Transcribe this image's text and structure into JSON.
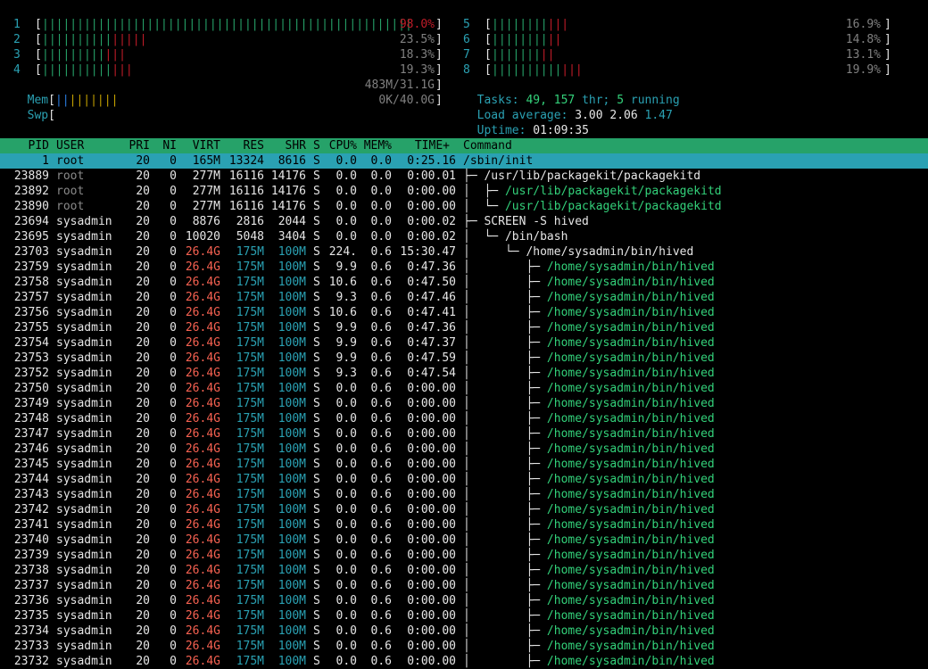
{
  "cpus": [
    {
      "id": "1",
      "value": "98.0%",
      "green": 53,
      "red": 0
    },
    {
      "id": "2",
      "value": "23.5%",
      "green": 10,
      "red": 5
    },
    {
      "id": "3",
      "value": "18.3%",
      "green": 9,
      "red": 3
    },
    {
      "id": "4",
      "value": "19.3%",
      "green": 10,
      "red": 3
    },
    {
      "id": "5",
      "value": "16.9%",
      "green": 8,
      "red": 3
    },
    {
      "id": "6",
      "value": "14.8%",
      "green": 8,
      "red": 2
    },
    {
      "id": "7",
      "value": "13.1%",
      "green": 7,
      "red": 2
    },
    {
      "id": "8",
      "value": "19.9%",
      "green": 10,
      "red": 3
    }
  ],
  "mem": {
    "label": "Mem",
    "value": "483M/31.1G"
  },
  "swp": {
    "label": "Swp",
    "value": "0K/40.0G"
  },
  "tasks": {
    "label": "Tasks:",
    "count": "49,",
    "thr": "157",
    "thr_label": "thr;",
    "running": "5",
    "running_label": "running"
  },
  "load": {
    "label": "Load average:",
    "v1": "3.00",
    "v5": "2.06",
    "v15": "1.47"
  },
  "uptime": {
    "label": "Uptime:",
    "value": "01:09:35"
  },
  "columns": {
    "pid": "PID",
    "user": "USER",
    "pri": "PRI",
    "ni": "NI",
    "virt": "VIRT",
    "res": "RES",
    "shr": "SHR",
    "s": "S",
    "cpu": "CPU%",
    "mem": "MEM%",
    "time": "TIME+",
    "cmd": "Command"
  },
  "processes": [
    {
      "pid": "1",
      "user": "root",
      "pri": "20",
      "ni": "0",
      "virt": "165M",
      "res": "13324",
      "shr": "8616",
      "s": "S",
      "cpu": "0.0",
      "mem": "0.0",
      "time": "0:25.16",
      "tree": "",
      "cmd": "/sbin/init",
      "sel": true
    },
    {
      "pid": "23889",
      "user": "root",
      "pri": "20",
      "ni": "0",
      "virt": "277M",
      "res": "16116",
      "shr": "14176",
      "s": "S",
      "cpu": "0.0",
      "mem": "0.0",
      "time": "0:00.01",
      "tree": "├─ ",
      "cmd": "/usr/lib/packagekit/packagekitd",
      "thread": false,
      "userdim": true
    },
    {
      "pid": "23892",
      "user": "root",
      "pri": "20",
      "ni": "0",
      "virt": "277M",
      "res": "16116",
      "shr": "14176",
      "s": "S",
      "cpu": "0.0",
      "mem": "0.0",
      "time": "0:00.00",
      "tree": "│  ├─ ",
      "cmd": "/usr/lib/packagekit/packagekitd",
      "thread": true,
      "userdim": true
    },
    {
      "pid": "23890",
      "user": "root",
      "pri": "20",
      "ni": "0",
      "virt": "277M",
      "res": "16116",
      "shr": "14176",
      "s": "S",
      "cpu": "0.0",
      "mem": "0.0",
      "time": "0:00.00",
      "tree": "│  └─ ",
      "cmd": "/usr/lib/packagekit/packagekitd",
      "thread": true,
      "userdim": true
    },
    {
      "pid": "23694",
      "user": "sysadmin",
      "pri": "20",
      "ni": "0",
      "virt": "8876",
      "res": "2816",
      "shr": "2044",
      "s": "S",
      "cpu": "0.0",
      "mem": "0.0",
      "time": "0:00.02",
      "tree": "├─ ",
      "cmd": "SCREEN -S hived",
      "thread": false
    },
    {
      "pid": "23695",
      "user": "sysadmin",
      "pri": "20",
      "ni": "0",
      "virt": "10020",
      "res": "5048",
      "shr": "3404",
      "s": "S",
      "cpu": "0.0",
      "mem": "0.0",
      "time": "0:00.02",
      "tree": "│  └─ ",
      "cmd": "/bin/bash",
      "thread": false
    },
    {
      "pid": "23703",
      "user": "sysadmin",
      "pri": "20",
      "ni": "0",
      "virt": "26.4G",
      "res": "175M",
      "shr": "100M",
      "s": "S",
      "cpu": "224.",
      "mem": "0.6",
      "time": "15:30.47",
      "tree": "│     └─ ",
      "cmd": "/home/sysadmin/bin/hived",
      "thread": false
    },
    {
      "pid": "23759",
      "user": "sysadmin",
      "pri": "20",
      "ni": "0",
      "virt": "26.4G",
      "res": "175M",
      "shr": "100M",
      "s": "S",
      "cpu": "9.9",
      "mem": "0.6",
      "time": "0:47.36",
      "tree": "│        ├─ ",
      "cmd": "/home/sysadmin/bin/hived",
      "thread": true
    },
    {
      "pid": "23758",
      "user": "sysadmin",
      "pri": "20",
      "ni": "0",
      "virt": "26.4G",
      "res": "175M",
      "shr": "100M",
      "s": "S",
      "cpu": "10.6",
      "mem": "0.6",
      "time": "0:47.50",
      "tree": "│        ├─ ",
      "cmd": "/home/sysadmin/bin/hived",
      "thread": true
    },
    {
      "pid": "23757",
      "user": "sysadmin",
      "pri": "20",
      "ni": "0",
      "virt": "26.4G",
      "res": "175M",
      "shr": "100M",
      "s": "S",
      "cpu": "9.3",
      "mem": "0.6",
      "time": "0:47.46",
      "tree": "│        ├─ ",
      "cmd": "/home/sysadmin/bin/hived",
      "thread": true
    },
    {
      "pid": "23756",
      "user": "sysadmin",
      "pri": "20",
      "ni": "0",
      "virt": "26.4G",
      "res": "175M",
      "shr": "100M",
      "s": "S",
      "cpu": "10.6",
      "mem": "0.6",
      "time": "0:47.41",
      "tree": "│        ├─ ",
      "cmd": "/home/sysadmin/bin/hived",
      "thread": true
    },
    {
      "pid": "23755",
      "user": "sysadmin",
      "pri": "20",
      "ni": "0",
      "virt": "26.4G",
      "res": "175M",
      "shr": "100M",
      "s": "S",
      "cpu": "9.9",
      "mem": "0.6",
      "time": "0:47.36",
      "tree": "│        ├─ ",
      "cmd": "/home/sysadmin/bin/hived",
      "thread": true
    },
    {
      "pid": "23754",
      "user": "sysadmin",
      "pri": "20",
      "ni": "0",
      "virt": "26.4G",
      "res": "175M",
      "shr": "100M",
      "s": "S",
      "cpu": "9.9",
      "mem": "0.6",
      "time": "0:47.37",
      "tree": "│        ├─ ",
      "cmd": "/home/sysadmin/bin/hived",
      "thread": true
    },
    {
      "pid": "23753",
      "user": "sysadmin",
      "pri": "20",
      "ni": "0",
      "virt": "26.4G",
      "res": "175M",
      "shr": "100M",
      "s": "S",
      "cpu": "9.9",
      "mem": "0.6",
      "time": "0:47.59",
      "tree": "│        ├─ ",
      "cmd": "/home/sysadmin/bin/hived",
      "thread": true
    },
    {
      "pid": "23752",
      "user": "sysadmin",
      "pri": "20",
      "ni": "0",
      "virt": "26.4G",
      "res": "175M",
      "shr": "100M",
      "s": "S",
      "cpu": "9.3",
      "mem": "0.6",
      "time": "0:47.54",
      "tree": "│        ├─ ",
      "cmd": "/home/sysadmin/bin/hived",
      "thread": true
    },
    {
      "pid": "23750",
      "user": "sysadmin",
      "pri": "20",
      "ni": "0",
      "virt": "26.4G",
      "res": "175M",
      "shr": "100M",
      "s": "S",
      "cpu": "0.0",
      "mem": "0.6",
      "time": "0:00.00",
      "tree": "│        ├─ ",
      "cmd": "/home/sysadmin/bin/hived",
      "thread": true
    },
    {
      "pid": "23749",
      "user": "sysadmin",
      "pri": "20",
      "ni": "0",
      "virt": "26.4G",
      "res": "175M",
      "shr": "100M",
      "s": "S",
      "cpu": "0.0",
      "mem": "0.6",
      "time": "0:00.00",
      "tree": "│        ├─ ",
      "cmd": "/home/sysadmin/bin/hived",
      "thread": true
    },
    {
      "pid": "23748",
      "user": "sysadmin",
      "pri": "20",
      "ni": "0",
      "virt": "26.4G",
      "res": "175M",
      "shr": "100M",
      "s": "S",
      "cpu": "0.0",
      "mem": "0.6",
      "time": "0:00.00",
      "tree": "│        ├─ ",
      "cmd": "/home/sysadmin/bin/hived",
      "thread": true
    },
    {
      "pid": "23747",
      "user": "sysadmin",
      "pri": "20",
      "ni": "0",
      "virt": "26.4G",
      "res": "175M",
      "shr": "100M",
      "s": "S",
      "cpu": "0.0",
      "mem": "0.6",
      "time": "0:00.00",
      "tree": "│        ├─ ",
      "cmd": "/home/sysadmin/bin/hived",
      "thread": true
    },
    {
      "pid": "23746",
      "user": "sysadmin",
      "pri": "20",
      "ni": "0",
      "virt": "26.4G",
      "res": "175M",
      "shr": "100M",
      "s": "S",
      "cpu": "0.0",
      "mem": "0.6",
      "time": "0:00.00",
      "tree": "│        ├─ ",
      "cmd": "/home/sysadmin/bin/hived",
      "thread": true
    },
    {
      "pid": "23745",
      "user": "sysadmin",
      "pri": "20",
      "ni": "0",
      "virt": "26.4G",
      "res": "175M",
      "shr": "100M",
      "s": "S",
      "cpu": "0.0",
      "mem": "0.6",
      "time": "0:00.00",
      "tree": "│        ├─ ",
      "cmd": "/home/sysadmin/bin/hived",
      "thread": true
    },
    {
      "pid": "23744",
      "user": "sysadmin",
      "pri": "20",
      "ni": "0",
      "virt": "26.4G",
      "res": "175M",
      "shr": "100M",
      "s": "S",
      "cpu": "0.0",
      "mem": "0.6",
      "time": "0:00.00",
      "tree": "│        ├─ ",
      "cmd": "/home/sysadmin/bin/hived",
      "thread": true
    },
    {
      "pid": "23743",
      "user": "sysadmin",
      "pri": "20",
      "ni": "0",
      "virt": "26.4G",
      "res": "175M",
      "shr": "100M",
      "s": "S",
      "cpu": "0.0",
      "mem": "0.6",
      "time": "0:00.00",
      "tree": "│        ├─ ",
      "cmd": "/home/sysadmin/bin/hived",
      "thread": true
    },
    {
      "pid": "23742",
      "user": "sysadmin",
      "pri": "20",
      "ni": "0",
      "virt": "26.4G",
      "res": "175M",
      "shr": "100M",
      "s": "S",
      "cpu": "0.0",
      "mem": "0.6",
      "time": "0:00.00",
      "tree": "│        ├─ ",
      "cmd": "/home/sysadmin/bin/hived",
      "thread": true
    },
    {
      "pid": "23741",
      "user": "sysadmin",
      "pri": "20",
      "ni": "0",
      "virt": "26.4G",
      "res": "175M",
      "shr": "100M",
      "s": "S",
      "cpu": "0.0",
      "mem": "0.6",
      "time": "0:00.00",
      "tree": "│        ├─ ",
      "cmd": "/home/sysadmin/bin/hived",
      "thread": true
    },
    {
      "pid": "23740",
      "user": "sysadmin",
      "pri": "20",
      "ni": "0",
      "virt": "26.4G",
      "res": "175M",
      "shr": "100M",
      "s": "S",
      "cpu": "0.0",
      "mem": "0.6",
      "time": "0:00.00",
      "tree": "│        ├─ ",
      "cmd": "/home/sysadmin/bin/hived",
      "thread": true
    },
    {
      "pid": "23739",
      "user": "sysadmin",
      "pri": "20",
      "ni": "0",
      "virt": "26.4G",
      "res": "175M",
      "shr": "100M",
      "s": "S",
      "cpu": "0.0",
      "mem": "0.6",
      "time": "0:00.00",
      "tree": "│        ├─ ",
      "cmd": "/home/sysadmin/bin/hived",
      "thread": true
    },
    {
      "pid": "23738",
      "user": "sysadmin",
      "pri": "20",
      "ni": "0",
      "virt": "26.4G",
      "res": "175M",
      "shr": "100M",
      "s": "S",
      "cpu": "0.0",
      "mem": "0.6",
      "time": "0:00.00",
      "tree": "│        ├─ ",
      "cmd": "/home/sysadmin/bin/hived",
      "thread": true
    },
    {
      "pid": "23737",
      "user": "sysadmin",
      "pri": "20",
      "ni": "0",
      "virt": "26.4G",
      "res": "175M",
      "shr": "100M",
      "s": "S",
      "cpu": "0.0",
      "mem": "0.6",
      "time": "0:00.00",
      "tree": "│        ├─ ",
      "cmd": "/home/sysadmin/bin/hived",
      "thread": true
    },
    {
      "pid": "23736",
      "user": "sysadmin",
      "pri": "20",
      "ni": "0",
      "virt": "26.4G",
      "res": "175M",
      "shr": "100M",
      "s": "S",
      "cpu": "0.0",
      "mem": "0.6",
      "time": "0:00.00",
      "tree": "│        ├─ ",
      "cmd": "/home/sysadmin/bin/hived",
      "thread": true
    },
    {
      "pid": "23735",
      "user": "sysadmin",
      "pri": "20",
      "ni": "0",
      "virt": "26.4G",
      "res": "175M",
      "shr": "100M",
      "s": "S",
      "cpu": "0.0",
      "mem": "0.6",
      "time": "0:00.00",
      "tree": "│        ├─ ",
      "cmd": "/home/sysadmin/bin/hived",
      "thread": true
    },
    {
      "pid": "23734",
      "user": "sysadmin",
      "pri": "20",
      "ni": "0",
      "virt": "26.4G",
      "res": "175M",
      "shr": "100M",
      "s": "S",
      "cpu": "0.0",
      "mem": "0.6",
      "time": "0:00.00",
      "tree": "│        ├─ ",
      "cmd": "/home/sysadmin/bin/hived",
      "thread": true
    },
    {
      "pid": "23733",
      "user": "sysadmin",
      "pri": "20",
      "ni": "0",
      "virt": "26.4G",
      "res": "175M",
      "shr": "100M",
      "s": "S",
      "cpu": "0.0",
      "mem": "0.6",
      "time": "0:00.00",
      "tree": "│        ├─ ",
      "cmd": "/home/sysadmin/bin/hived",
      "thread": true
    },
    {
      "pid": "23732",
      "user": "sysadmin",
      "pri": "20",
      "ni": "0",
      "virt": "26.4G",
      "res": "175M",
      "shr": "100M",
      "s": "S",
      "cpu": "0.0",
      "mem": "0.6",
      "time": "0:00.00",
      "tree": "│        ├─ ",
      "cmd": "/home/sysadmin/bin/hived",
      "thread": true
    }
  ]
}
